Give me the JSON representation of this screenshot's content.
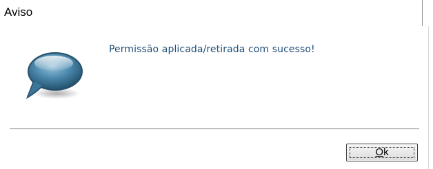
{
  "dialog": {
    "title": "Aviso",
    "message": "Permissão aplicada/retirada com sucesso!",
    "icon": "speech-bubble-icon",
    "ok_button": {
      "mnemonic": "O",
      "rest": "k"
    }
  },
  "colors": {
    "message_text": "#1f4e79",
    "icon_blue": "#3f7fa6"
  }
}
